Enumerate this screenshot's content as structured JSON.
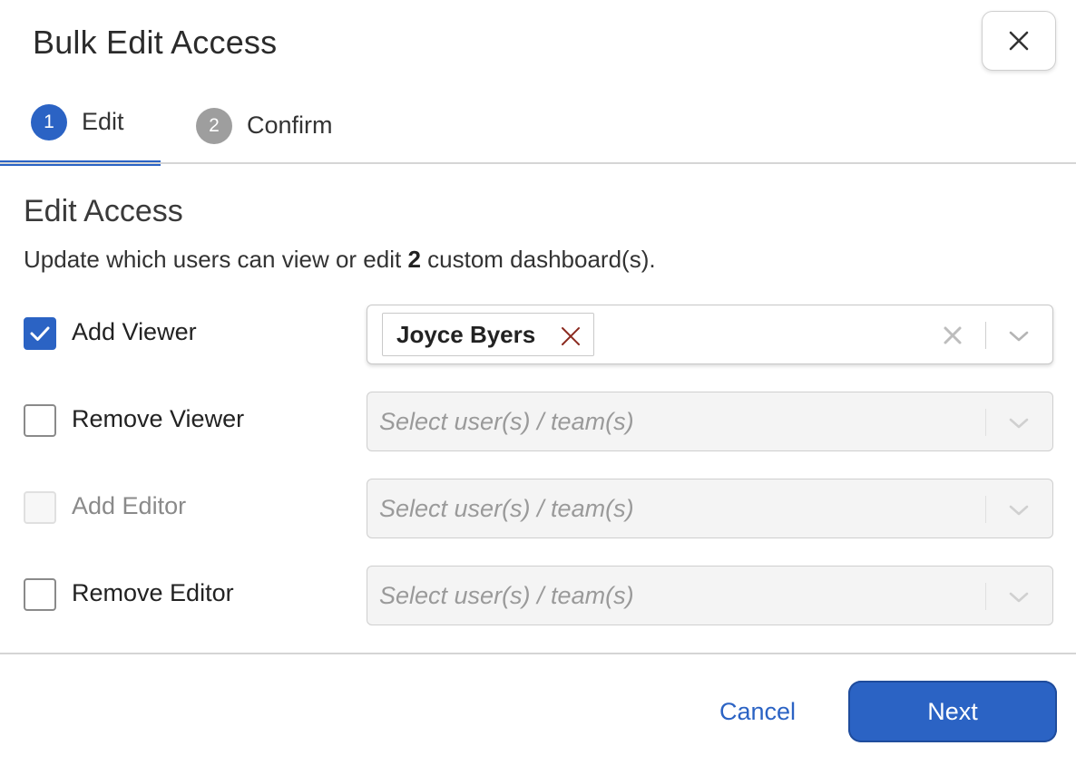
{
  "dialog": {
    "title": "Bulk Edit Access",
    "close_icon": "close-icon"
  },
  "tabs": [
    {
      "number": "1",
      "label": "Edit",
      "active": true
    },
    {
      "number": "2",
      "label": "Confirm",
      "active": false
    }
  ],
  "section": {
    "title": "Edit Access",
    "description_pre": "Update which users can view or edit ",
    "description_count": "2",
    "description_post": " custom dashboard(s)."
  },
  "rows": [
    {
      "label": "Add Viewer",
      "checked": true,
      "disabled": false,
      "chip": "Joyce Byers"
    },
    {
      "label": "Remove Viewer",
      "checked": false,
      "disabled": false,
      "placeholder": "Select user(s) / team(s)"
    },
    {
      "label": "Add Editor",
      "checked": false,
      "disabled": true,
      "placeholder": "Select user(s) / team(s)"
    },
    {
      "label": "Remove Editor",
      "checked": false,
      "disabled": false,
      "placeholder": "Select user(s) / team(s)"
    }
  ],
  "footer": {
    "cancel_label": "Cancel",
    "next_label": "Next"
  },
  "colors": {
    "accent": "#2b63c4",
    "chip_remove": "#8b2a1f"
  }
}
